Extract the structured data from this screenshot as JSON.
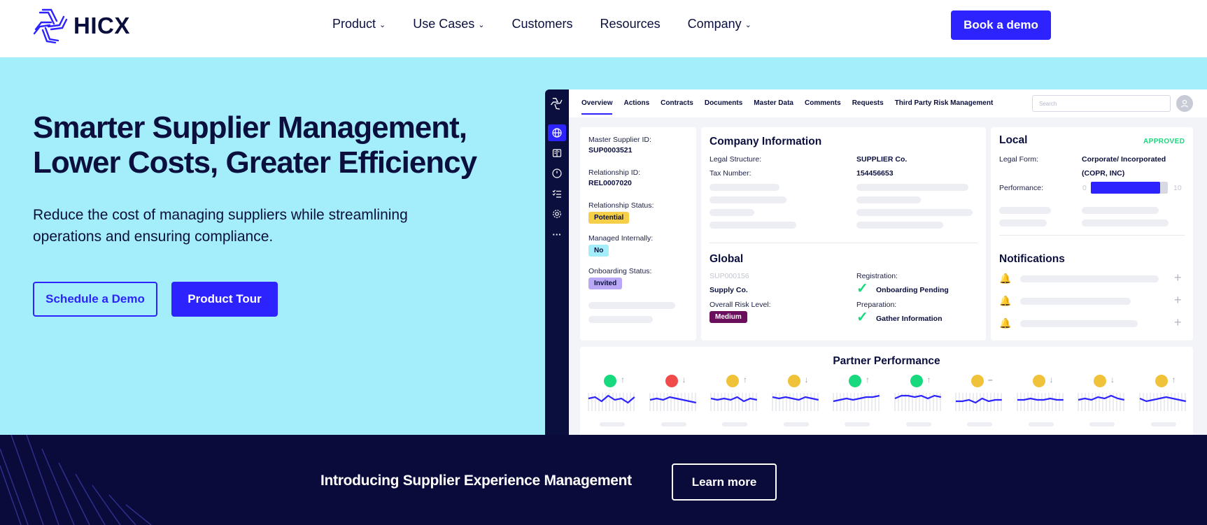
{
  "brand": {
    "name": "HICX",
    "logo_icon": "hicx-logo-icon",
    "accent": "#2d23ff",
    "navy": "#0b0f3d"
  },
  "nav": {
    "items": [
      {
        "label": "Product",
        "has_dropdown": true
      },
      {
        "label": "Use Cases",
        "has_dropdown": true
      },
      {
        "label": "Customers",
        "has_dropdown": false
      },
      {
        "label": "Resources",
        "has_dropdown": false
      },
      {
        "label": "Company",
        "has_dropdown": true
      }
    ],
    "cta": "Book a demo"
  },
  "hero": {
    "title_line1": "Smarter Supplier Management,",
    "title_line2": "Lower Costs, Greater Efficiency",
    "subtitle_line1": "Reduce the cost of managing suppliers while streamlining",
    "subtitle_line2": "operations and ensuring compliance.",
    "primary_cta": "Schedule a Demo",
    "secondary_cta": "Product Tour",
    "background": "#a3eefa"
  },
  "app": {
    "sidebar_icons": [
      "hicx-logo-icon",
      "globe-icon",
      "book-icon",
      "gauge-icon",
      "checklist-icon",
      "gear-icon",
      "more-icon"
    ],
    "tabs": [
      "Overview",
      "Actions",
      "Contracts",
      "Documents",
      "Master Data",
      "Comments",
      "Requests",
      "Third Party Risk Management"
    ],
    "active_tab": "Overview",
    "search_placeholder": "Search",
    "summary": {
      "master_supplier_id_label": "Master Supplier ID:",
      "master_supplier_id": "SUP0003521",
      "relationship_id_label": "Relationship ID:",
      "relationship_id": "REL0007020",
      "relationship_status_label": "Relationship Status:",
      "relationship_status": "Potential",
      "managed_internally_label": "Managed Internally:",
      "managed_internally": "No",
      "onboarding_status_label": "Onboarding Status:",
      "onboarding_status": "Invited"
    },
    "company_info": {
      "title": "Company Information",
      "legal_structure_label": "Legal Structure:",
      "legal_structure": "SUPPLIER Co.",
      "tax_number_label": "Tax Number:",
      "tax_number": "154456653"
    },
    "global": {
      "title": "Global",
      "faded_id": "SUP000156",
      "name": "Supply Co.",
      "risk_label": "Overall Risk Level:",
      "risk_value": "Medium",
      "registration_label": "Registration:",
      "registration_value": "Onboarding Pending",
      "preparation_label": "Preparation:",
      "preparation_value": "Gather Information"
    },
    "local": {
      "title": "Local",
      "status": "APPROVED",
      "legal_form_label": "Legal Form:",
      "legal_form_line1": "Corporate/ Incorporated",
      "legal_form_line2": "(COPR, INC)",
      "performance_label": "Performance:",
      "performance_min": "0",
      "performance_max": "10",
      "performance_value": 9
    },
    "notifications": {
      "title": "Notifications",
      "count": 3
    },
    "partner_performance": {
      "title": "Partner Performance",
      "items": [
        {
          "status": "#18d97e",
          "trend": "up"
        },
        {
          "status": "#f04a4a",
          "trend": "down"
        },
        {
          "status": "#f0c23a",
          "trend": "up"
        },
        {
          "status": "#f0c23a",
          "trend": "down"
        },
        {
          "status": "#18d97e",
          "trend": "up"
        },
        {
          "status": "#18d97e",
          "trend": "up"
        },
        {
          "status": "#f0c23a",
          "trend": "flat"
        },
        {
          "status": "#f0c23a",
          "trend": "down"
        },
        {
          "status": "#f0c23a",
          "trend": "down"
        },
        {
          "status": "#f0c23a",
          "trend": "up"
        }
      ]
    }
  },
  "banner": {
    "text": "Introducing Supplier Experience Management",
    "cta": "Learn more"
  }
}
